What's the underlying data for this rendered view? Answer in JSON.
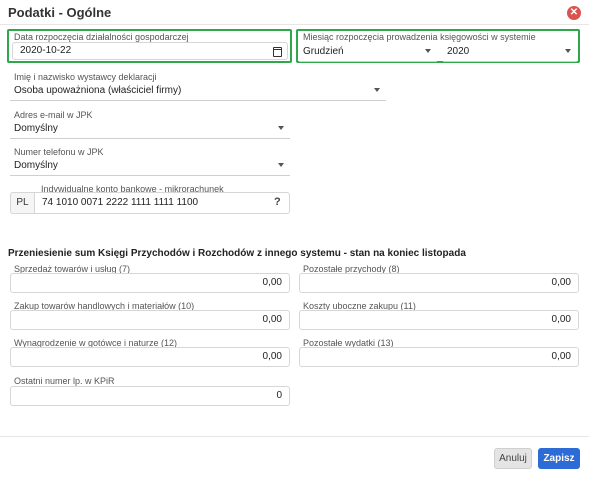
{
  "dialog": {
    "title": "Podatki - Ogólne"
  },
  "start_date": {
    "label": "Data rozpoczęcia działalności gospodarczej",
    "value": "2020-10-22"
  },
  "accounting_start": {
    "label": "Miesiąc rozpoczęcia prowadzenia księgowości w systemie",
    "month": "Grudzień",
    "year": "2020"
  },
  "declarant": {
    "label": "Imię i nazwisko wystawcy deklaracji",
    "value": "Osoba upoważniona (właściciel firmy)"
  },
  "jpk_email": {
    "label": "Adres e-mail w JPK",
    "value": "Domyślny"
  },
  "jpk_phone": {
    "label": "Numer telefonu w JPK",
    "value": "Domyślny"
  },
  "bank_account": {
    "label": "Indywidualne konto bankowe - mikrorachunek",
    "prefix": "PL",
    "value": "74 1010 0071 2222 1111 1111 1100",
    "help": "?"
  },
  "transfer_section": {
    "title": "Przeniesienie sum Księgi Przychodów i Rozchodów z innego systemu - stan na koniec listopada",
    "fields": [
      {
        "label": "Sprzedaż towarów i usług (7)",
        "value": "0,00"
      },
      {
        "label": "Pozostałe przychody (8)",
        "value": "0,00"
      },
      {
        "label": "Zakup towarów handlowych i materiałów (10)",
        "value": "0,00"
      },
      {
        "label": "Koszty uboczne zakupu (11)",
        "value": "0,00"
      },
      {
        "label": "Wynagrodzenie w gotówce i naturze (12)",
        "value": "0,00"
      },
      {
        "label": "Pozostałe wydatki (13)",
        "value": "0,00"
      }
    ],
    "last_kpir": {
      "label": "Ostatni numer lp. w KPiR",
      "value": "0"
    }
  },
  "footer": {
    "cancel_label": "Anuluj",
    "save_label": "Zapisz"
  },
  "colors": {
    "highlight": "#2ea84b",
    "primary": "#2d6bd6",
    "close": "#d9534f"
  }
}
